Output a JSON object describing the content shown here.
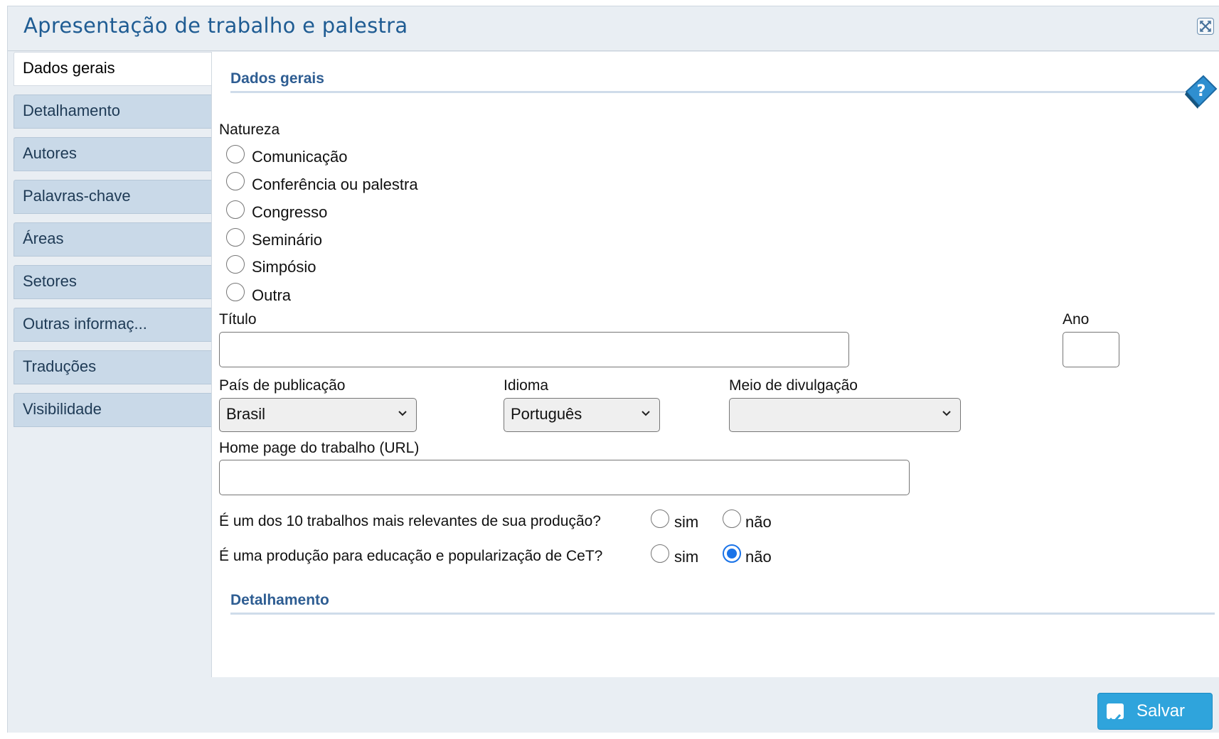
{
  "window": {
    "title": "Apresentação de trabalho e palestra"
  },
  "tabs": [
    {
      "label": "Dados gerais",
      "active": true
    },
    {
      "label": "Detalhamento"
    },
    {
      "label": "Autores"
    },
    {
      "label": "Palavras-chave"
    },
    {
      "label": "Áreas"
    },
    {
      "label": "Setores"
    },
    {
      "label": "Outras informaç..."
    },
    {
      "label": "Traduções"
    },
    {
      "label": "Visibilidade"
    }
  ],
  "sections": {
    "general": "Dados gerais",
    "details": "Detalhamento"
  },
  "form": {
    "natureza_label": "Natureza",
    "natureza_options": [
      "Comunicação",
      "Conferência ou palestra",
      "Congresso",
      "Seminário",
      "Simpósio",
      "Outra"
    ],
    "titulo_label": "Título",
    "titulo_value": "",
    "ano_label": "Ano",
    "ano_value": "",
    "pais_label": "País de publicação",
    "pais_value": "Brasil",
    "idioma_label": "Idioma",
    "idioma_value": "Português",
    "meio_label": "Meio de divulgação",
    "meio_value": "",
    "homepage_label": "Home page do trabalho (URL)",
    "homepage_value": "",
    "relevant_question": "É um dos 10 trabalhos mais relevantes de sua produção?",
    "education_question": "É uma produção para educação e popularização de CeT?",
    "yes_label": "sim",
    "no_label": "não",
    "relevant_answer": null,
    "education_answer": "não"
  },
  "actions": {
    "save_label": "Salvar"
  },
  "colors": {
    "accent": "#2e5d92",
    "save_button": "#2fa4dc",
    "radio_checked": "#1a73e8"
  }
}
